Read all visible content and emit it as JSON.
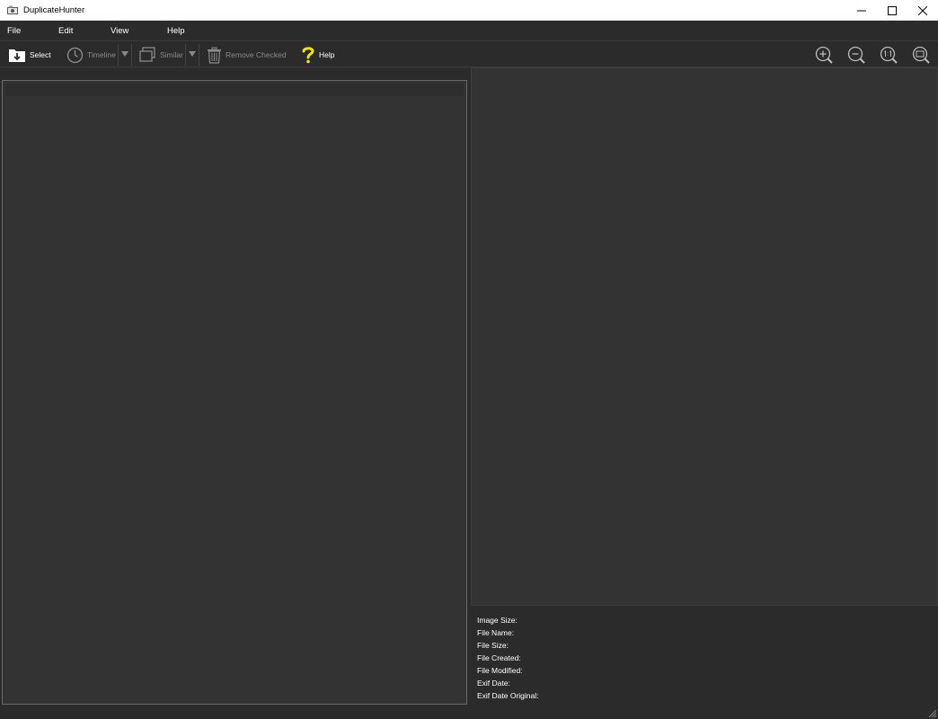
{
  "window": {
    "title": "DuplicateHunter",
    "controls": [
      "minimize-icon",
      "maximize-icon",
      "close-icon"
    ]
  },
  "menu": {
    "items": [
      {
        "label": "File"
      },
      {
        "label": "Edit"
      },
      {
        "label": "View"
      },
      {
        "label": "Help"
      }
    ]
  },
  "toolbar": {
    "select_label": "Select",
    "timeline_label": "Timeline",
    "similar_label": "Similar",
    "remove_label": "Remove Checked",
    "help_label": "Help",
    "zoom_icons": [
      "zoom-in-icon",
      "zoom-out-icon",
      "zoom-actual-size-icon",
      "zoom-fit-icon"
    ]
  },
  "info": {
    "image_size_label": "Image Size:",
    "file_name_label": "File Name:",
    "file_size_label": "File Size:",
    "file_created_label": "File Created:",
    "file_modified_label": "File Modified:",
    "exif_date_label": "Exif Date:",
    "exif_date_original_label": "Exif Date Original:"
  },
  "colors": {
    "background": "#2b2b2b",
    "panel": "#333333",
    "help_accent": "#f5e600",
    "disabled_text": "#8a8a8a"
  }
}
